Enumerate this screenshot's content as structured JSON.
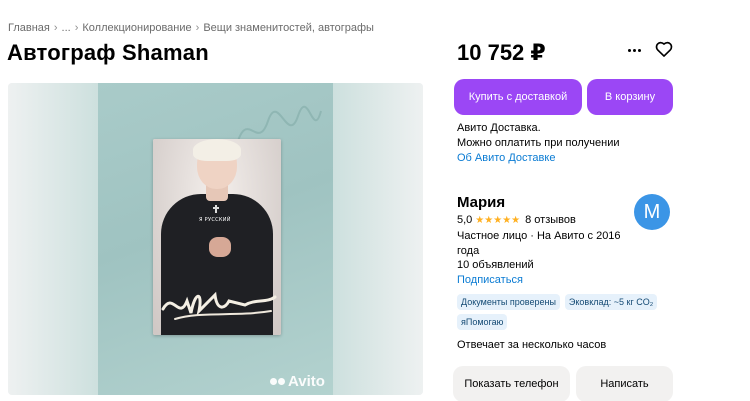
{
  "breadcrumb": {
    "items": [
      "Главная",
      "...",
      "Коллекционирование",
      "Вещи знаменитостей, автографы"
    ],
    "separator": "›"
  },
  "listing": {
    "title": "Автограф Shaman",
    "price": "10 752 ₽"
  },
  "gallery": {
    "tee_text": "Я РУССКИЙ",
    "watermark": "Avito"
  },
  "actions": {
    "buy_with_delivery": "Купить с доставкой",
    "add_to_cart": "В корзину",
    "more_icon": "more-dots-icon",
    "favorite_icon": "heart-icon"
  },
  "delivery": {
    "line1": "Авито Доставка.",
    "line2": "Можно оплатить при получении",
    "link": "Об Авито Доставке"
  },
  "seller": {
    "name": "Мария",
    "avatar_letter": "М",
    "rating": "5,0",
    "stars": "★★★★★",
    "reviews": "8 отзывов",
    "type": "Частное лицо · На Авито с 2016 года",
    "ads": "10 объявлений",
    "subscribe": "Подписаться",
    "badges": [
      "Документы проверены",
      "Эковклад: ~5 кг CO₂",
      "яПомогаю"
    ],
    "response_time": "Отвечает за несколько часов"
  },
  "contact": {
    "show_phone": "Показать телефон",
    "write": "Написать"
  },
  "colors": {
    "primary": "#9b47f5",
    "link": "#0a7bd3",
    "avatar": "#3b95e6",
    "star": "#ffb021",
    "badge_bg": "#e6f1fb"
  }
}
